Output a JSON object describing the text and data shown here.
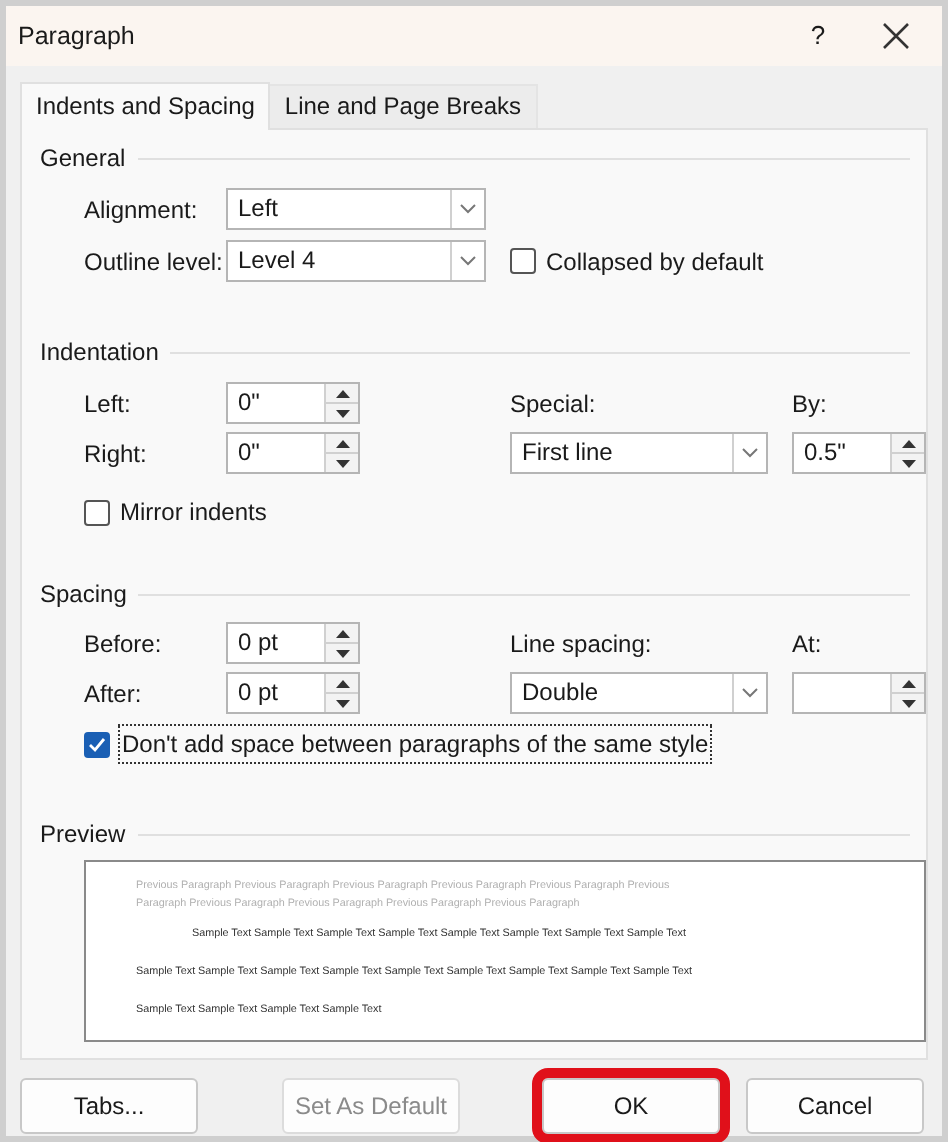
{
  "window": {
    "title": "Paragraph",
    "help": "?"
  },
  "tabs": [
    {
      "label": "Indents and Spacing",
      "selected": true
    },
    {
      "label": "Line and Page Breaks",
      "selected": false
    }
  ],
  "general": {
    "title": "General",
    "alignment": {
      "label": "Alignment:",
      "value": "Left"
    },
    "outline_level": {
      "label": "Outline level:",
      "value": "Level 4"
    },
    "collapsed": {
      "label": "Collapsed by default",
      "checked": false
    }
  },
  "indentation": {
    "title": "Indentation",
    "left": {
      "label": "Left:",
      "value": "0\""
    },
    "right": {
      "label": "Right:",
      "value": "0\""
    },
    "special": {
      "label": "Special:",
      "value": "First line"
    },
    "by": {
      "label": "By:",
      "value": "0.5\""
    },
    "mirror": {
      "label": "Mirror indents",
      "checked": false
    }
  },
  "spacing": {
    "title": "Spacing",
    "before": {
      "label": "Before:",
      "value": "0 pt"
    },
    "after": {
      "label": "After:",
      "value": "0 pt"
    },
    "line_spacing": {
      "label": "Line spacing:",
      "value": "Double"
    },
    "at": {
      "label": "At:"
    },
    "dont_add_space": {
      "label": "Don't add space between paragraphs of the same style",
      "checked": true
    }
  },
  "preview": {
    "title": "Preview",
    "previous_lines": [
      "Previous Paragraph Previous Paragraph Previous Paragraph Previous Paragraph Previous Paragraph Previous",
      "Paragraph Previous Paragraph Previous Paragraph Previous Paragraph Previous Paragraph"
    ],
    "sample_lines": [
      "Sample Text Sample Text Sample Text Sample Text Sample Text Sample Text Sample Text Sample Text",
      "Sample Text Sample Text Sample Text Sample Text Sample Text Sample Text Sample Text Sample Text Sample Text",
      "Sample Text Sample Text Sample Text Sample Text"
    ]
  },
  "buttons": [
    {
      "label": "Tabs...",
      "disabled": false,
      "highlighted": false
    },
    {
      "label": "Set As Default",
      "disabled": true,
      "highlighted": false
    },
    {
      "label": "OK",
      "disabled": false,
      "highlighted": true
    },
    {
      "label": "Cancel",
      "disabled": false,
      "highlighted": false
    }
  ]
}
